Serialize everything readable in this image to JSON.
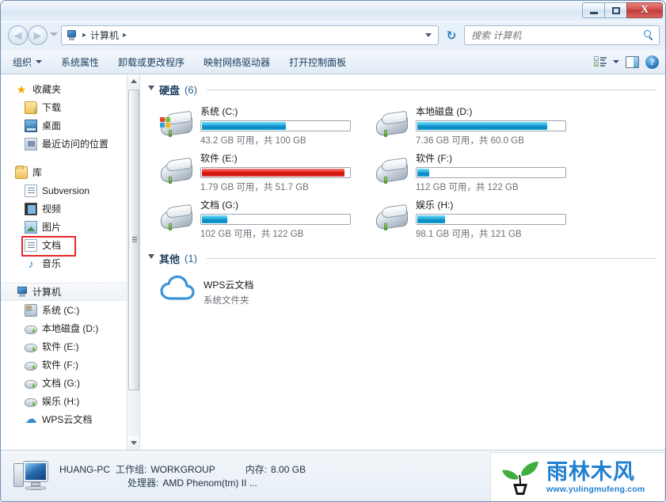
{
  "window": {
    "controls": {
      "minimize": "—",
      "maximize": "❐",
      "close": "X"
    }
  },
  "address": {
    "back_icon": "back-arrow-icon",
    "forward_icon": "forward-arrow-icon",
    "history_icon": "history-dropdown-icon",
    "breadcrumb_icon": "computer-icon",
    "breadcrumb": "计算机",
    "separator": "▸",
    "dropdown_icon": "chevron-down-icon",
    "refresh_icon": "refresh-icon",
    "refresh_glyph": "↻"
  },
  "search": {
    "placeholder": "搜索 计算机",
    "value": "",
    "icon": "search-icon"
  },
  "toolbar": {
    "organize": "组织",
    "items": [
      "系统属性",
      "卸载或更改程序",
      "映射网络驱动器",
      "打开控制面板"
    ],
    "view_icon": "view-mode-icon",
    "view_caret_icon": "chevron-down-icon",
    "pane_icon": "preview-pane-icon",
    "help_icon": "help-icon",
    "help_glyph": "?"
  },
  "sidebar": {
    "groups": [
      {
        "label": "收藏夹",
        "icon": "star-icon",
        "items": [
          {
            "label": "下载",
            "icon": "downloads-icon"
          },
          {
            "label": "桌面",
            "icon": "desktop-icon"
          },
          {
            "label": "最近访问的位置",
            "icon": "recent-places-icon"
          }
        ]
      },
      {
        "label": "库",
        "icon": "library-icon",
        "items": [
          {
            "label": "Subversion",
            "icon": "document-icon"
          },
          {
            "label": "视频",
            "icon": "video-icon"
          },
          {
            "label": "图片",
            "icon": "pictures-icon"
          },
          {
            "label": "文档",
            "icon": "document-icon",
            "highlighted": true
          },
          {
            "label": "音乐",
            "icon": "music-icon"
          }
        ]
      },
      {
        "label": "计算机",
        "icon": "computer-icon",
        "selected": true,
        "items": [
          {
            "label": "系统 (C:)",
            "icon": "system-drive-icon"
          },
          {
            "label": "本地磁盘 (D:)",
            "icon": "hard-drive-icon"
          },
          {
            "label": "软件 (E:)",
            "icon": "hard-drive-icon"
          },
          {
            "label": "软件 (F:)",
            "icon": "hard-drive-icon"
          },
          {
            "label": "文档 (G:)",
            "icon": "hard-drive-icon"
          },
          {
            "label": "娱乐 (H:)",
            "icon": "hard-drive-icon"
          },
          {
            "label": "WPS云文档",
            "icon": "cloud-icon"
          }
        ]
      }
    ],
    "scroll_up_icon": "scroll-up-icon",
    "scroll_down_icon": "scroll-down-icon",
    "highlight_color": "#e8262a"
  },
  "content": {
    "groups": [
      {
        "label": "硬盘",
        "count": "(6)"
      },
      {
        "label": "其他",
        "count": "(1)"
      }
    ],
    "drives": [
      {
        "name": "系统 (C:)",
        "free_text": "43.2 GB 可用，共 100 GB",
        "used_pct": 57,
        "bar_color": "blue",
        "icon": "system-drive-icon",
        "is_system": true
      },
      {
        "name": "本地磁盘 (D:)",
        "free_text": "7.36 GB 可用，共 60.0 GB",
        "used_pct": 88,
        "bar_color": "blue",
        "icon": "hard-drive-icon",
        "is_system": false
      },
      {
        "name": "软件 (E:)",
        "free_text": "1.79 GB 可用，共 51.7 GB",
        "used_pct": 97,
        "bar_color": "red",
        "icon": "hard-drive-icon",
        "is_system": false
      },
      {
        "name": "软件 (F:)",
        "free_text": "112 GB 可用，共 122 GB",
        "used_pct": 8,
        "bar_color": "blue",
        "icon": "hard-drive-icon",
        "is_system": false
      },
      {
        "name": "文档 (G:)",
        "free_text": "102 GB 可用，共 122 GB",
        "used_pct": 17,
        "bar_color": "blue",
        "icon": "hard-drive-icon",
        "is_system": false
      },
      {
        "name": "娱乐 (H:)",
        "free_text": "98.1 GB 可用，共 121 GB",
        "used_pct": 19,
        "bar_color": "blue",
        "icon": "hard-drive-icon",
        "is_system": false
      }
    ],
    "other": {
      "name": "WPS云文档",
      "type": "系统文件夹",
      "icon": "cloud-icon"
    }
  },
  "status": {
    "icon": "computer-icon",
    "pc_name": "HUANG-PC",
    "workgroup_label": "工作组:",
    "workgroup_value": "WORKGROUP",
    "memory_label": "内存:",
    "memory_value": "8.00 GB",
    "cpu_label": "处理器:",
    "cpu_value": "AMD Phenom(tm) II ..."
  },
  "watermark": {
    "logo_icon": "sprout-logo-icon",
    "title": "雨林木风",
    "url": "www.yulingmufeng.com",
    "color": "#1f7fd0"
  }
}
